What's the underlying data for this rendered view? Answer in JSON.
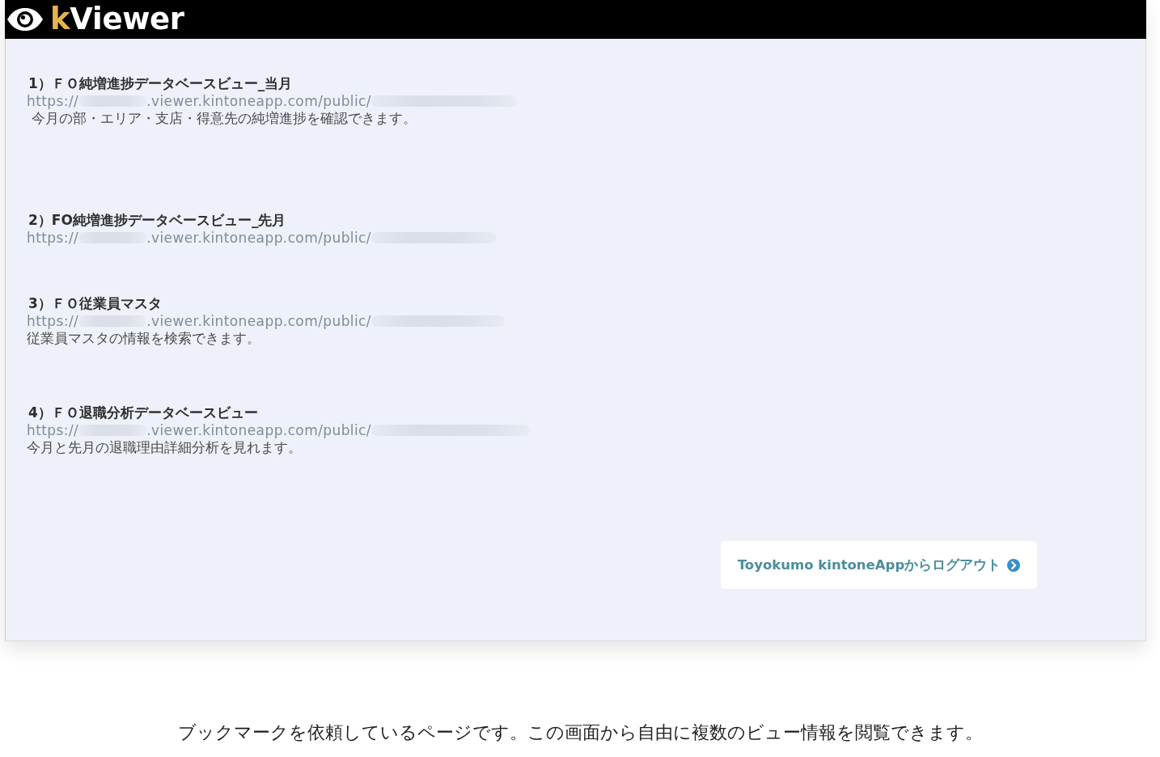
{
  "header": {
    "logo": {
      "initial": "k",
      "rest": "Viewer"
    }
  },
  "views": [
    {
      "title": "1）ＦＯ純増進捗データベースビュー_当月",
      "url": {
        "scheme": "https://",
        "host_path": ".viewer.kintoneapp.com/public/"
      },
      "description": "今月の部・エリア・支店・得意先の純増進捗を確認できます。"
    },
    {
      "title": "2）FO純増進捗データベースビュー_先月",
      "url": {
        "scheme": "https://",
        "host_path": ".viewer.kintoneapp.com/public/"
      }
    },
    {
      "title": "3）ＦＯ従業員マスタ",
      "url": {
        "scheme": "https://",
        "host_path": ".viewer.kintoneapp.com/public/"
      },
      "description": "従業員マスタの情報を検索できます。"
    },
    {
      "title": "4）ＦＯ退職分析データベースビュー",
      "url": {
        "scheme": "https://",
        "host_path": ".viewer.kintoneapp.com/public/"
      },
      "description": "今月と先月の退職理由詳細分析を見れます。"
    }
  ],
  "logout_button": {
    "label": "Toyokumo kintoneAppからログアウト"
  },
  "caption": "ブックマークを依頼しているページです。この画面から自由に複数のビュー情報を閲覧できます。"
}
